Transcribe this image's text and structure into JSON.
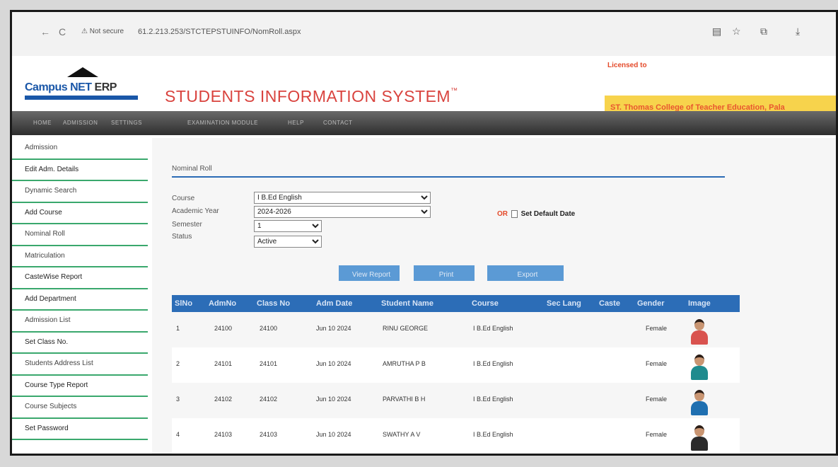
{
  "browser": {
    "back": "←",
    "reload": "C",
    "security": "⚠ Not secure",
    "url": "61.2.213.253/STCTEPSTUINFO/NomRoll.aspx"
  },
  "header": {
    "logo_campus": "Campus NET",
    "logo_erp": "ERP",
    "title": "STUDENTS INFORMATION SYSTEM",
    "tm": "™",
    "licensed_label": "Licensed to",
    "licensee": "ST. Thomas College of Teacher Education, Pala"
  },
  "menu": [
    "HOME",
    "ADMISSION",
    "SETTINGS",
    "EXAMINATION MODULE",
    "HELP",
    "CONTACT"
  ],
  "sidebar": [
    "Admission",
    "Edit Adm. Details",
    "Dynamic Search",
    "Add Course",
    "Nominal Roll",
    "Matriculation",
    "CasteWise Report",
    "Add Department",
    "Admission List",
    "Set Class No.",
    "Students Address List",
    "Course Type Report",
    "Course Subjects",
    "Set Password"
  ],
  "main": {
    "section_title": "Nominal Roll",
    "labels": {
      "course": "Course",
      "academic_year": "Academic Year",
      "semester": "Semester",
      "status": "Status"
    },
    "values": {
      "course": "I B.Ed English",
      "academic_year": "2024-2026",
      "semester": "1",
      "status": "Active"
    },
    "or_text": "OR",
    "set_default": "Set Default Date",
    "buttons": {
      "view_report": "View Report",
      "print": "Print",
      "export": "Export"
    }
  },
  "table": {
    "headers": [
      "SlNo",
      "AdmNo",
      "Class No",
      "Adm Date",
      "Student Name",
      "Course",
      "Sec Lang",
      "Caste",
      "Gender",
      "Image"
    ],
    "rows": [
      {
        "slno": "1",
        "admno": "24100",
        "classno": "24100",
        "date": "Jun 10 2024",
        "name": "RINU GEORGE",
        "course": "I B.Ed English",
        "gender": "Female"
      },
      {
        "slno": "2",
        "admno": "24101",
        "classno": "24101",
        "date": "Jun 10 2024",
        "name": "AMRUTHA P B",
        "course": "I B.Ed English",
        "gender": "Female"
      },
      {
        "slno": "3",
        "admno": "24102",
        "classno": "24102",
        "date": "Jun 10 2024",
        "name": "PARVATHI B H",
        "course": "I B.Ed English",
        "gender": "Female"
      },
      {
        "slno": "4",
        "admno": "24103",
        "classno": "24103",
        "date": "Jun 10 2024",
        "name": "SWATHY A V",
        "course": "I B.Ed English",
        "gender": "Female"
      }
    ]
  }
}
